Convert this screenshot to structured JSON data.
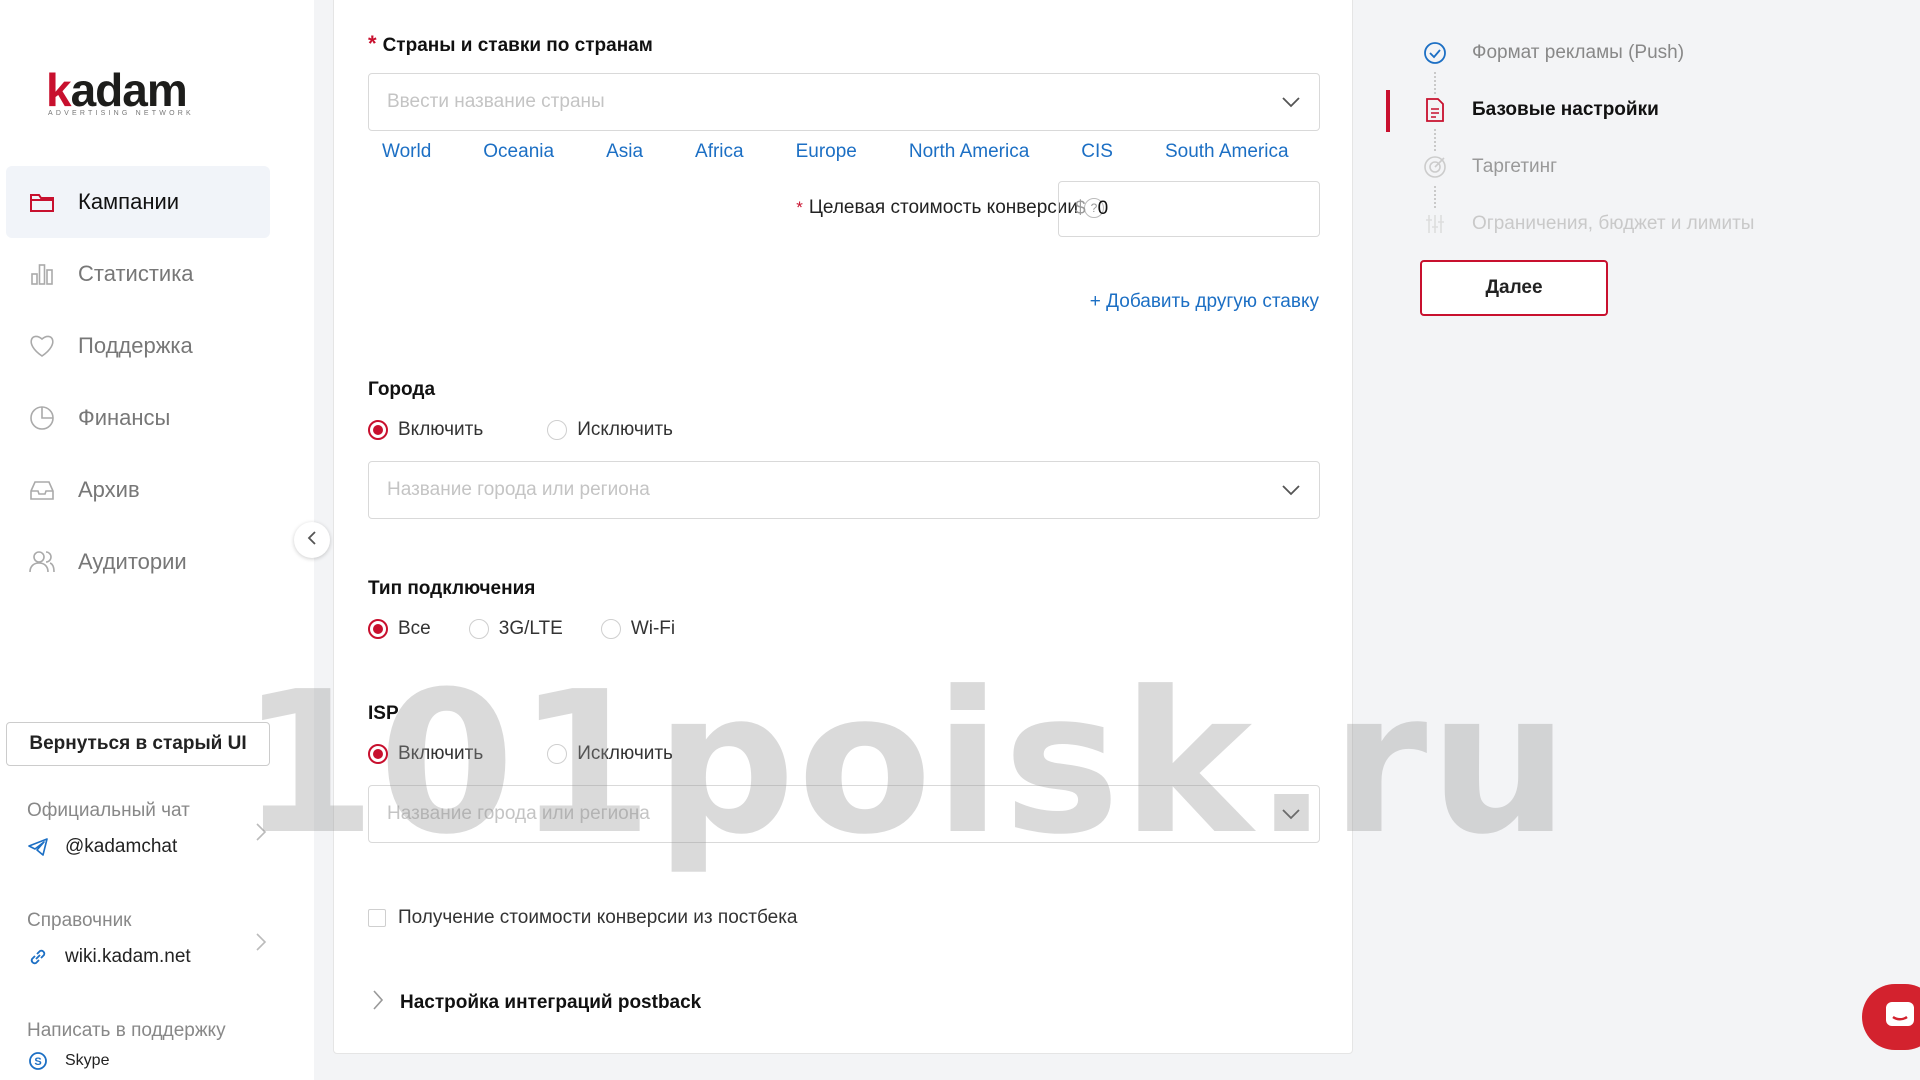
{
  "brand": {
    "logo_k": "k",
    "logo_rest": "adam",
    "logo_sub": "ADVERTISING NETWORK",
    "accent": "#c8102e",
    "link_color": "#1c6fc4"
  },
  "sidebar": {
    "items": [
      {
        "label": "Кампании",
        "icon": "folder-icon",
        "active": true
      },
      {
        "label": "Статистика",
        "icon": "bar-chart-icon"
      },
      {
        "label": "Поддержка",
        "icon": "heart-icon"
      },
      {
        "label": "Финансы",
        "icon": "pie-chart-icon"
      },
      {
        "label": "Архив",
        "icon": "inbox-icon"
      },
      {
        "label": "Аудитории",
        "icon": "users-icon"
      }
    ],
    "old_ui_label": "Вернуться в старый UI",
    "chat": {
      "title": "Официальный чат",
      "link": "@kadamchat",
      "icon": "telegram-icon"
    },
    "wiki": {
      "title": "Справочник",
      "link": "wiki.kadam.net",
      "icon": "link-icon"
    },
    "support": {
      "title": "Написать в поддержку",
      "link": "Skype",
      "icon": "skype-icon"
    }
  },
  "main": {
    "countries": {
      "title": "Страны и ставки по странам",
      "placeholder": "Ввести название страны",
      "regions": [
        "World",
        "Oceania",
        "Asia",
        "Africa",
        "Europe",
        "North America",
        "CIS",
        "South America"
      ],
      "conversion_label": "Целевая стоимость конверсии",
      "help": "?",
      "currency": "$",
      "conversion_value": "0",
      "add_rate": "+ Добавить другую ставку"
    },
    "cities": {
      "title": "Города",
      "include": "Включить",
      "exclude": "Исключить",
      "placeholder": "Название города или региона"
    },
    "connection": {
      "title": "Тип подключения",
      "options": [
        "Все",
        "3G/LTE",
        "Wi-Fi"
      ],
      "selected": "Все"
    },
    "isp": {
      "title": "ISP",
      "include": "Включить",
      "exclude": "Исключить",
      "placeholder": "Название города или региона"
    },
    "postback_checkbox": "Получение стоимости конверсии из постбека",
    "postback_settings": "Настройка интеграций postback"
  },
  "steps": {
    "items": [
      {
        "label": "Формат рекламы (Push)",
        "state": "done",
        "icon": "check-circle-icon"
      },
      {
        "label": "Базовые настройки",
        "state": "active",
        "icon": "document-icon"
      },
      {
        "label": "Таргетинг",
        "state": "pending",
        "icon": "target-icon"
      },
      {
        "label": "Ограничения, бюджет и лимиты",
        "state": "disabled",
        "icon": "sliders-icon"
      }
    ],
    "next_label": "Далее"
  },
  "watermark": "101poisk.ru"
}
